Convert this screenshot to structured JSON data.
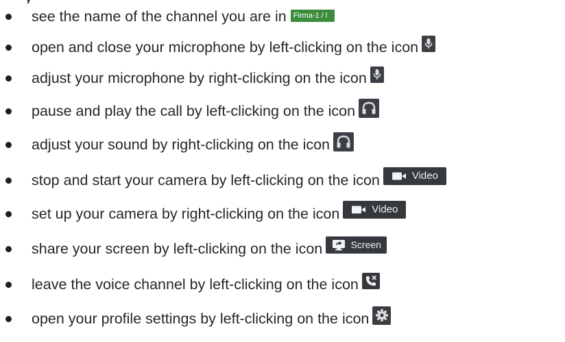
{
  "top_fragment": "y",
  "items": [
    {
      "text": "see the name of the channel you are in",
      "icon": "channel-name-badge",
      "icon_label": "Firma-1 / l"
    },
    {
      "text": "open and close your microphone by left-clicking on the icon",
      "icon": "microphone-icon"
    },
    {
      "text": "adjust your microphone by right-clicking on the icon",
      "icon": "microphone-icon"
    },
    {
      "text": "pause and play the call by left-clicking on the icon",
      "icon": "headphones-icon"
    },
    {
      "text": "adjust your sound by right-clicking on the icon",
      "icon": "headphones-icon"
    },
    {
      "text": "stop and start your camera by left-clicking on the icon",
      "icon": "camera-icon",
      "icon_label": "Video"
    },
    {
      "text": "set up your camera by right-clicking on the icon",
      "icon": "camera-icon",
      "icon_label": "Video"
    },
    {
      "text": "share your screen by left-clicking on the icon",
      "icon": "screen-share-icon",
      "icon_label": "Screen"
    },
    {
      "text": "leave the voice channel by left-clicking on the icon",
      "icon": "disconnect-call-icon"
    },
    {
      "text": "open your profile settings by left-clicking on the icon",
      "icon": "gear-icon"
    }
  ],
  "colors": {
    "text": "#262626",
    "button_bg": "#36393f",
    "icon_fg": "#dcddde",
    "channel_badge": "#3c8c3c"
  }
}
